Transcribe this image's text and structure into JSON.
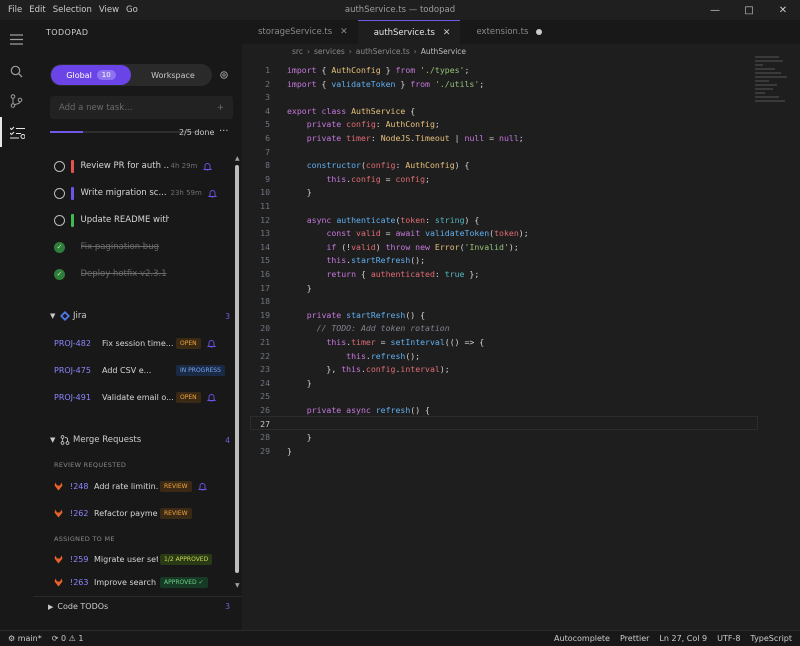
{
  "menu": [
    "File",
    "Edit",
    "Selection",
    "View",
    "Go"
  ],
  "window_title": "authService.ts — todopad",
  "sidebar": {
    "title": "TODOPAD",
    "scope_global": "Global",
    "scope_global_count": "10",
    "scope_workspace": "Workspace",
    "new_task_placeholder": "Add a new task...",
    "new_task_add": "+",
    "progress_fraction": 0.4,
    "done_label": "2/5 done",
    "tasks": [
      {
        "text": "Review PR for auth ...",
        "time": "4h 29m",
        "priority_color": "#e5534b",
        "done": false
      },
      {
        "text": "Write migration sc...",
        "time": "23h 59m",
        "priority_color": "#6a54e8",
        "done": false
      },
      {
        "text": "Update README with API ...",
        "time": "",
        "priority_color": "#3fb950",
        "done": false
      },
      {
        "text": "Fix pagination bug",
        "time": "",
        "priority_color": "",
        "done": true
      },
      {
        "text": "Deploy hotfix v2.3.1",
        "time": "",
        "priority_color": "",
        "done": true
      }
    ],
    "jira": {
      "label": "Jira",
      "count": "3",
      "issues": [
        {
          "key": "PROJ-482",
          "title": "Fix session time...",
          "status": "OPEN"
        },
        {
          "key": "PROJ-475",
          "title": "Add CSV e...",
          "status": "IN PROGRESS"
        },
        {
          "key": "PROJ-491",
          "title": "Validate email o...",
          "status": "OPEN"
        }
      ]
    },
    "merge_requests": {
      "label": "Merge Requests",
      "count": "4",
      "review_requested_label": "REVIEW REQUESTED",
      "review_requested": [
        {
          "num": "!248",
          "title": "Add rate limitin...",
          "status": "REVIEW"
        },
        {
          "num": "!262",
          "title": "Refactor payme...",
          "status": "REVIEW"
        }
      ],
      "assigned_label": "ASSIGNED TO ME",
      "assigned": [
        {
          "num": "!259",
          "title": "Migrate user sett...",
          "status": "1/2 APPROVED"
        },
        {
          "num": "!263",
          "title": "Improve search q...",
          "status": "APPROVED ✓"
        }
      ]
    },
    "code_todos": {
      "label": "Code TODOs",
      "count": "3"
    }
  },
  "tabs": [
    {
      "name": "storageService.ts",
      "close": "✕"
    },
    {
      "name": "authService.ts",
      "close": "✕"
    },
    {
      "name": "extension.ts",
      "close": ""
    }
  ],
  "breadcrumb": [
    "src",
    "services",
    "authService.ts",
    "AuthService"
  ],
  "breadcrumb_sep": "›",
  "status_bar": {
    "branch": "main*",
    "problems": "0 ⚠ 1",
    "autocomplete": "Autocomplete",
    "prettier": "Prettier",
    "position": "Ln 27, Col 9",
    "encoding": "UTF-8",
    "language": "TypeScript"
  }
}
